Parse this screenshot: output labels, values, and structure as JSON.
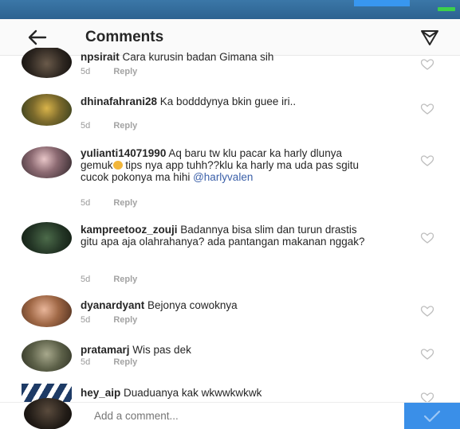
{
  "header": {
    "title": "Comments"
  },
  "comments": [
    {
      "username": "npsirait",
      "text": "Cara kurusin badan Gimana sih",
      "time": "5d",
      "reply": "Reply"
    },
    {
      "username": "dhinafahrani28",
      "text": "Ka bodddynya bkin guee iri..",
      "time": "5d",
      "reply": "Reply"
    },
    {
      "username": "yulianti14071990",
      "text_before_emoji": "Aq baru tw klu pacar ka harly dlunya gemuk",
      "text_after_emoji": "tips nya app tuhh??klu ka harly ma uda pas sgitu cucok pokonya ma hihi",
      "mention": "@harlyvalen",
      "time": "5d",
      "reply": "Reply"
    },
    {
      "username": "kampreetooz_zouji",
      "text": "Badannya bisa slim dan turun drastis gitu apa aja olahrahanya? ada pantangan makanan nggak?",
      "time": "5d",
      "reply": "Reply"
    },
    {
      "username": "dyanardyant",
      "text": "Bejonya cowoknya",
      "time": "5d",
      "reply": "Reply"
    },
    {
      "username": "pratamarj",
      "text": "Wis pas dek",
      "time": "5d",
      "reply": "Reply"
    },
    {
      "username": "hey_aip",
      "text": "Duaduanya kak wkwwkwkwk",
      "time": "",
      "reply": ""
    }
  ],
  "compose": {
    "placeholder": "Add a comment..."
  },
  "colors": {
    "accent_blue": "#3a8fe8",
    "status_bar": "#2f6a9b",
    "mention": "#3a5fa8",
    "muted_text": "#9a9a9a"
  },
  "icons": {
    "back": "arrow-left-icon",
    "send": "paper-plane-icon",
    "like": "heart-outline-icon",
    "post": "checkmark-icon"
  }
}
